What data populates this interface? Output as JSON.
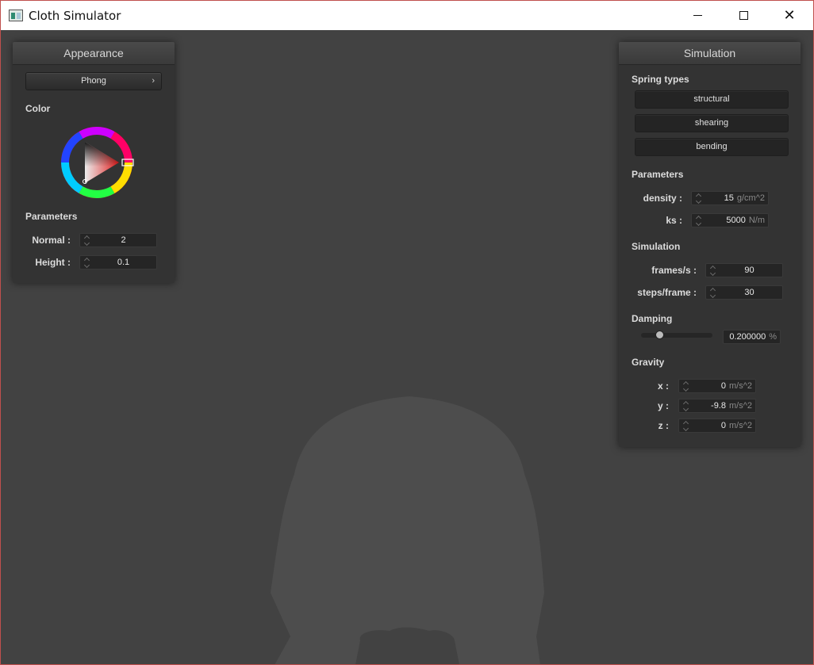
{
  "window": {
    "title": "Cloth Simulator"
  },
  "appearance": {
    "title": "Appearance",
    "shader": "Phong",
    "color_label": "Color",
    "color_hex": "#d62020",
    "parameters_label": "Parameters",
    "normal_label": "Normal :",
    "normal_value": "2",
    "height_label": "Height :",
    "height_value": "0.1"
  },
  "simulation": {
    "title": "Simulation",
    "spring_types_label": "Spring types",
    "spring_types": [
      "structural",
      "shearing",
      "bending"
    ],
    "parameters_label": "Parameters",
    "density_label": "density :",
    "density_value": "15",
    "density_unit": "g/cm^2",
    "ks_label": "ks :",
    "ks_value": "5000",
    "ks_unit": "N/m",
    "sim_label": "Simulation",
    "fps_label": "frames/s :",
    "fps_value": "90",
    "steps_label": "steps/frame :",
    "steps_value": "30",
    "damping_label": "Damping",
    "damping_slider_fraction": 0.2,
    "damping_value": "0.200000",
    "damping_unit": "%",
    "gravity_label": "Gravity",
    "gx_label": "x :",
    "gx_value": "0",
    "gy_label": "y :",
    "gy_value": "-9.8",
    "gz_label": "z :",
    "gz_value": "0",
    "gravity_unit": "m/s^2"
  },
  "colors": {
    "background": "#424242",
    "cloth": "#4d4d4d",
    "panel": "#333333"
  }
}
